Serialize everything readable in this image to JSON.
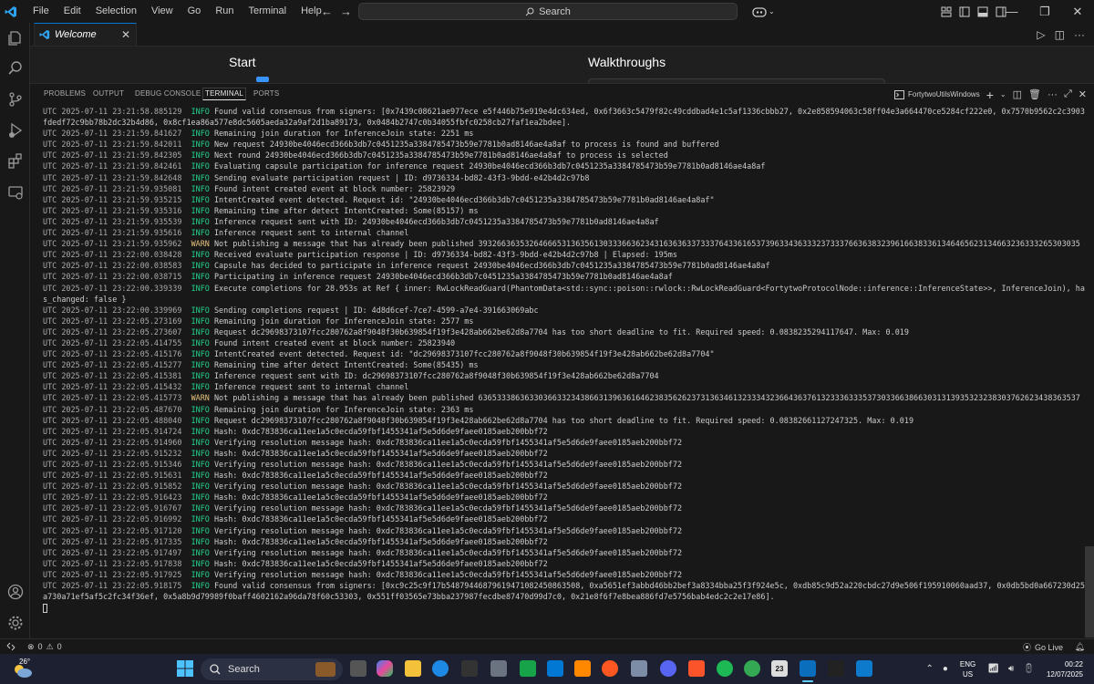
{
  "menu": [
    "File",
    "Edit",
    "Selection",
    "View",
    "Go",
    "Run",
    "Terminal",
    "Help"
  ],
  "search": {
    "label": "Search"
  },
  "tabs": [
    {
      "label": "Welcome"
    }
  ],
  "editor": {
    "start_heading": "Start",
    "walkthroughs_heading": "Walkthroughs"
  },
  "panel": {
    "tabs": [
      "PROBLEMS",
      "OUTPUT",
      "DEBUG CONSOLE",
      "TERMINAL",
      "PORTS"
    ],
    "active_tab": "TERMINAL",
    "terminal_name": "FortytwoUtilsWindows"
  },
  "terminal": {
    "lines": [
      {
        "ts": "UTC 2025-07-11 23:21:58.885129",
        "level": "INFO",
        "msg": "Found valid consensus from signers: [0x7439c08621ae977ece e5f446b75e919e4dc634ed, 0x6f3663c5479f82c49cddbad4e1c5af1336cbbb27, 0x2e858594063c58ff04e3a664470ce5284cf222e0, 0x7570b9562c2c3903fdedf72c9bb78b2dc32b4d86, 0x8cf1ea86a577e8dc5605aeda32a9af2d1ba89173, 0x0484b2747c0b34055fbfc0258cb27faf1ea2bdee]."
      },
      {
        "ts": "UTC 2025-07-11 23:21:59.841627",
        "level": "INFO",
        "msg": "Remaining join duration for InferenceJoin state: 2251 ms"
      },
      {
        "ts": "UTC 2025-07-11 23:21:59.842011",
        "level": "INFO",
        "msg": "New request 24930be4046ecd366b3db7c0451235a3384785473b59e7781b0ad8146ae4a8af to process is found and buffered"
      },
      {
        "ts": "UTC 2025-07-11 23:21:59.842305",
        "level": "INFO",
        "msg": "Next round 24930be4046ecd366b3db7c0451235a3384785473b59e7781b0ad8146ae4a8af to process is selected"
      },
      {
        "ts": "UTC 2025-07-11 23:21:59.842461",
        "level": "INFO",
        "msg": "Evaluating capsule participation for inference request 24930be4046ecd366b3db7c0451235a3384785473b59e7781b0ad8146ae4a8af"
      },
      {
        "ts": "UTC 2025-07-11 23:21:59.842648",
        "level": "INFO",
        "msg": "Sending evaluate participation request | ID: d9736334-bd82-43f3-9bdd-e42b4d2c97b8"
      },
      {
        "ts": "UTC 2025-07-11 23:21:59.935081",
        "level": "INFO",
        "msg": "Found intent created event at block number: 25823929"
      },
      {
        "ts": "UTC 2025-07-11 23:21:59.935215",
        "level": "INFO",
        "msg": "IntentCreated event detected. Request id: \"24930be4046ecd366b3db7c0451235a3384785473b59e7781b0ad8146ae4a8af\""
      },
      {
        "ts": "UTC 2025-07-11 23:21:59.935316",
        "level": "INFO",
        "msg": "Remaining time after detect IntentCreated: Some(85157) ms"
      },
      {
        "ts": "UTC 2025-07-11 23:21:59.935539",
        "level": "INFO",
        "msg": "Inference request sent with ID: 24930be4046ecd366b3db7c0451235a3384785473b59e7781b0ad8146ae4a8af"
      },
      {
        "ts": "UTC 2025-07-11 23:21:59.935616",
        "level": "INFO",
        "msg": "Inference request sent to internal channel"
      },
      {
        "ts": "UTC 2025-07-11 23:21:59.935962",
        "level": "WARN",
        "msg": "Not publishing a message that has already been published 3932663635326466653136356130333663623431636363373337643361653739633436333237333766363832396166383361346465623134663236333265303035"
      },
      {
        "ts": "UTC 2025-07-11 23:22:00.038428",
        "level": "INFO",
        "msg": "Received evaluate participation response | ID: d9736334-bd82-43f3-9bdd-e42b4d2c97b8 | Elapsed: 195ms"
      },
      {
        "ts": "UTC 2025-07-11 23:22:00.038583",
        "level": "INFO",
        "msg": "Capsule has decided to participate in inference request 24930be4046ecd366b3db7c0451235a3384785473b59e7781b0ad8146ae4a8af"
      },
      {
        "ts": "UTC 2025-07-11 23:22:00.038715",
        "level": "INFO",
        "msg": "Participating in inference request 24930be4046ecd366b3db7c0451235a3384785473b59e7781b0ad8146ae4a8af"
      },
      {
        "ts": "UTC 2025-07-11 23:22:00.339339",
        "level": "INFO",
        "msg": "Execute completions for 28.953s at Ref { inner: RwLockReadGuard(PhantomData<std::sync::poison::rwlock::RwLockReadGuard<FortytwoProtocolNode::inference::InferenceState>>, InferenceJoin), has_changed: false }"
      },
      {
        "ts": "UTC 2025-07-11 23:22:00.339969",
        "level": "INFO",
        "msg": "Sending completions request | ID: 4d8d6cef-7ce7-4599-a7e4-391663069abc"
      },
      {
        "ts": "UTC 2025-07-11 23:22:05.273169",
        "level": "INFO",
        "msg": "Remaining join duration for InferenceJoin state: 2577 ms"
      },
      {
        "ts": "UTC 2025-07-11 23:22:05.273607",
        "level": "INFO",
        "msg": "Request dc29698373107fcc280762a8f9048f30b639854f19f3e428ab662be62d8a7704 has too short deadline to fit. Required speed: 0.0838235294117647. Max: 0.019"
      },
      {
        "ts": "UTC 2025-07-11 23:22:05.414755",
        "level": "INFO",
        "msg": "Found intent created event at block number: 25823940"
      },
      {
        "ts": "UTC 2025-07-11 23:22:05.415176",
        "level": "INFO",
        "msg": "IntentCreated event detected. Request id: \"dc29698373107fcc280762a8f9048f30b639854f19f3e428ab662be62d8a7704\""
      },
      {
        "ts": "UTC 2025-07-11 23:22:05.415277",
        "level": "INFO",
        "msg": "Remaining time after detect IntentCreated: Some(85435) ms"
      },
      {
        "ts": "UTC 2025-07-11 23:22:05.415381",
        "level": "INFO",
        "msg": "Inference request sent with ID: dc29698373107fcc280762a8f9048f30b639854f19f3e428ab662be62d8a7704"
      },
      {
        "ts": "UTC 2025-07-11 23:22:05.415432",
        "level": "INFO",
        "msg": "Inference request sent to internal channel"
      },
      {
        "ts": "UTC 2025-07-11 23:22:05.415773",
        "level": "WARN",
        "msg": "Not publishing a message that has already been published 6365333863633036633234386631396361646238356262373136346132333432366436376132333633353730336638663031313935323238303762623438363537"
      },
      {
        "ts": "UTC 2025-07-11 23:22:05.487670",
        "level": "INFO",
        "msg": "Remaining join duration for InferenceJoin state: 2363 ms"
      },
      {
        "ts": "UTC 2025-07-11 23:22:05.488040",
        "level": "INFO",
        "msg": "Request dc29698373107fcc280762a8f9048f30b639854f19f3e428ab662be62d8a7704 has too short deadline to fit. Required speed: 0.08382661127247325. Max: 0.019"
      },
      {
        "ts": "UTC 2025-07-11 23:22:05.914724",
        "level": "INFO",
        "msg": "Hash: 0xdc783836ca11ee1a5c0ecda59fbf1455341af5e5d6de9faee0185aeb200bbf72"
      },
      {
        "ts": "UTC 2025-07-11 23:22:05.914960",
        "level": "INFO",
        "msg": "Verifying resolution message hash: 0xdc783836ca11ee1a5c0ecda59fbf1455341af5e5d6de9faee0185aeb200bbf72"
      },
      {
        "ts": "UTC 2025-07-11 23:22:05.915232",
        "level": "INFO",
        "msg": "Hash: 0xdc783836ca11ee1a5c0ecda59fbf1455341af5e5d6de9faee0185aeb200bbf72"
      },
      {
        "ts": "UTC 2025-07-11 23:22:05.915346",
        "level": "INFO",
        "msg": "Verifying resolution message hash: 0xdc783836ca11ee1a5c0ecda59fbf1455341af5e5d6de9faee0185aeb200bbf72"
      },
      {
        "ts": "UTC 2025-07-11 23:22:05.915631",
        "level": "INFO",
        "msg": "Hash: 0xdc783836ca11ee1a5c0ecda59fbf1455341af5e5d6de9faee0185aeb200bbf72"
      },
      {
        "ts": "UTC 2025-07-11 23:22:05.915852",
        "level": "INFO",
        "msg": "Verifying resolution message hash: 0xdc783836ca11ee1a5c0ecda59fbf1455341af5e5d6de9faee0185aeb200bbf72"
      },
      {
        "ts": "UTC 2025-07-11 23:22:05.916423",
        "level": "INFO",
        "msg": "Hash: 0xdc783836ca11ee1a5c0ecda59fbf1455341af5e5d6de9faee0185aeb200bbf72"
      },
      {
        "ts": "UTC 2025-07-11 23:22:05.916767",
        "level": "INFO",
        "msg": "Verifying resolution message hash: 0xdc783836ca11ee1a5c0ecda59fbf1455341af5e5d6de9faee0185aeb200bbf72"
      },
      {
        "ts": "UTC 2025-07-11 23:22:05.916992",
        "level": "INFO",
        "msg": "Hash: 0xdc783836ca11ee1a5c0ecda59fbf1455341af5e5d6de9faee0185aeb200bbf72"
      },
      {
        "ts": "UTC 2025-07-11 23:22:05.917120",
        "level": "INFO",
        "msg": "Verifying resolution message hash: 0xdc783836ca11ee1a5c0ecda59fbf1455341af5e5d6de9faee0185aeb200bbf72"
      },
      {
        "ts": "UTC 2025-07-11 23:22:05.917335",
        "level": "INFO",
        "msg": "Hash: 0xdc783836ca11ee1a5c0ecda59fbf1455341af5e5d6de9faee0185aeb200bbf72"
      },
      {
        "ts": "UTC 2025-07-11 23:22:05.917497",
        "level": "INFO",
        "msg": "Verifying resolution message hash: 0xdc783836ca11ee1a5c0ecda59fbf1455341af5e5d6de9faee0185aeb200bbf72"
      },
      {
        "ts": "UTC 2025-07-11 23:22:05.917838",
        "level": "INFO",
        "msg": "Hash: 0xdc783836ca11ee1a5c0ecda59fbf1455341af5e5d6de9faee0185aeb200bbf72"
      },
      {
        "ts": "UTC 2025-07-11 23:22:05.917925",
        "level": "INFO",
        "msg": "Verifying resolution message hash: 0xdc783836ca11ee1a5c0ecda59fbf1455341af5e5d6de9faee0185aeb200bbf72"
      },
      {
        "ts": "UTC 2025-07-11 23:22:05.918175",
        "level": "INFO",
        "msg": "Found valid consensus from signers: [0xc9c25c9f17b54879446879619471082450863508, 0xa5651ef3abbd46bb2bef3a8334bba25f3f924e5c, 0xdb85c9d52a220cbdc27d9e506f195910060aad37, 0x0db5bd0a667230d25a730a71ef5af5c2fc34f36ef, 0x5a8b9d79989f0baff4602162a96da78f60c53303, 0x551ff03565e73bba237987fecdbe87470d99d7c0, 0x21e8f6f7e8bea886fd7e5756bab4edc2c2e17e86]."
      }
    ]
  },
  "statusbar": {
    "errors": "0",
    "warnings": "0",
    "golive": "Go Live"
  },
  "taskbar": {
    "weather_temp": "26°",
    "search_label": "Search",
    "lang_line1": "ENG",
    "lang_line2": "US",
    "time": "00:22",
    "date": "12/07/2025",
    "calendar_day": "23"
  }
}
